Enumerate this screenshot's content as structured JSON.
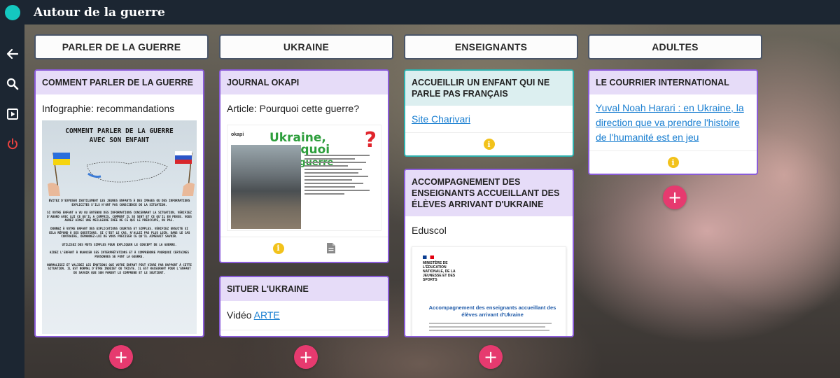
{
  "app": {
    "title": "Autour de la guerre",
    "accent": "#14c8c0",
    "bar_color": "#1c2632"
  },
  "sidebar": {
    "items": [
      {
        "icon": "arrow-left-icon"
      },
      {
        "icon": "search-icon"
      },
      {
        "icon": "play-icon"
      },
      {
        "icon": "power-icon"
      }
    ]
  },
  "columns": [
    {
      "header": "PARLER DE LA GUERRE",
      "cards": [
        {
          "title": "COMMENT PARLER DE LA GUERRE",
          "text": "Infographie: recommandations",
          "image": {
            "title_line1": "COMMENT PARLER DE LA GUERRE",
            "title_line2": "AVEC SON ENFANT",
            "p1": "ÉVITEZ D'EXPOSER INUTILEMENT LES JEUNES ENFANTS À DES IMAGES OU DES INFORMATIONS EXPLICITES S'ILS N'ONT PAS CONSCIENCE DE LA SITUATION.",
            "p2": "SI VOTRE ENFANT A VU OU ENTENDU DES INFORMATIONS CONCERNANT LA SITUATION, VÉRIFIEZ D'ABORD AVEC LUI CE QU'IL A COMPRIS, COMMENT IL SE SENT ET CE QU'IL EN PENSE. VOUS AUREZ AINSI UNE MEILLEURE IDÉE DE CE QUI LE PRÉOCCUPE, OU PAS.",
            "p3": "DONNEZ À VOTRE ENFANT DES EXPLICATIONS COURTES ET SIMPLES. VÉRIFIEZ ENSUITE SI CELA RÉPOND À SES QUESTIONS. SI C'EST LE CAS, N'ALLEZ PAS PLUS LOIN. DANS LE CAS CONTRAIRE, DEMANDEZ-LUI DE VOUS PRÉCISER CE QU'IL AIMERAIT SAVOIR.",
            "p4": "UTILISEZ DES MOTS SIMPLES POUR EXPLIQUER LE CONCEPT DE LA GUERRE.",
            "p5": "AIDEZ L'ENFANT À NUANCER SES INTERPRÉTATIONS ET À COMPRENDRE POURQUOI CERTAINES PERSONNES SE FONT LA GUERRE.",
            "p6": "NORMALISEZ ET VALIDEZ LES ÉMOTIONS QUE VOTRE ENFANT PEUT VIVRE PAR RAPPORT À CETTE SITUATION. IL EST NORMAL D'ÊTRE INQUIET OU TRISTE. IL EST RASSURANT POUR L'ENFANT DE SAVOIR QUE SON PARENT LE COMPREND ET LE SOUTIENT."
          }
        }
      ]
    },
    {
      "header": "UKRAINE",
      "cards": [
        {
          "title": "JOURNAL OKAPI",
          "text": "Article: Pourquoi cette guerre?",
          "image": {
            "brand": "okapi",
            "headline1": "Ukraine, pourquoi",
            "headline2": "cette guerre",
            "mark": "?"
          }
        },
        {
          "title": "SITUER L'UKRAINE",
          "text_prefix": "Vidéo ",
          "link": "ARTE"
        }
      ]
    },
    {
      "header": "ENSEIGNANTS",
      "cards": [
        {
          "title": "ACCUEILLIR UN ENFANT QUI NE PARLE PAS FRANÇAIS",
          "link": "Site Charivari"
        },
        {
          "title": "ACCOMPAGNEMENT DES ENSEIGNANTS ACCUEILLANT DES ÉLÈVES ARRIVANT D'UKRAINE",
          "text": "Eduscol",
          "image": {
            "ministry": "MINISTÈRE DE L'ÉDUCATION NATIONALE, DE LA JEUNESSE ET DES SPORTS",
            "doc_title": "Accompagnement des enseignants accueillant des élèves arrivant d'Ukraine"
          }
        }
      ]
    },
    {
      "header": "ADULTES",
      "cards": [
        {
          "title": "LE COURRIER INTERNATIONAL",
          "link": "Yuval Noah Harari : en Ukraine, la direction que va prendre l'histoire de l'humanité est en jeu"
        }
      ]
    }
  ],
  "add_label": "+",
  "info_label": "i"
}
